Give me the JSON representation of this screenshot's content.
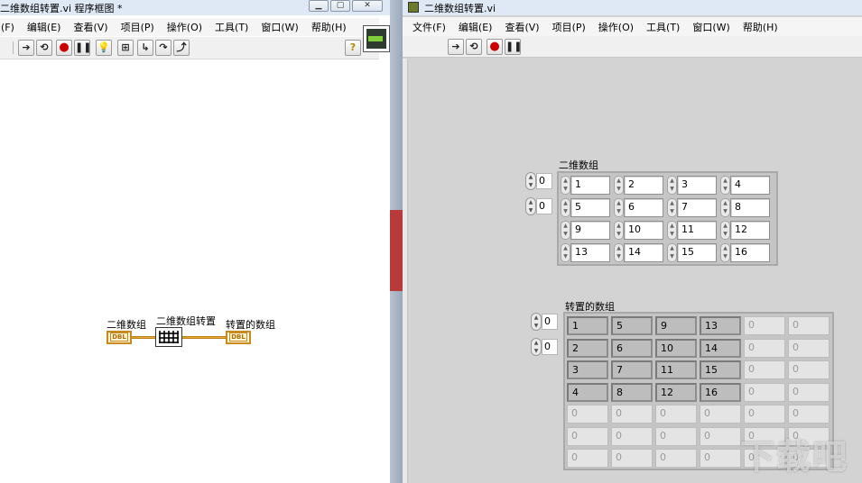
{
  "left_window": {
    "title": "二维数组转置.vi 程序框图 *",
    "menus": [
      "(F)",
      "编辑(E)",
      "查看(V)",
      "项目(P)",
      "操作(O)",
      "工具(T)",
      "窗口(W)",
      "帮助(H)"
    ],
    "diagram": {
      "input_label": "二维数组",
      "input_type": "DBL",
      "function_label": "二维数组转置",
      "output_label": "转置的数组",
      "output_type": "DBL"
    }
  },
  "right_window": {
    "title": "二维数组转置.vi",
    "menus": [
      "文件(F)",
      "编辑(E)",
      "查看(V)",
      "项目(P)",
      "操作(O)",
      "工具(T)",
      "窗口(W)",
      "帮助(H)"
    ]
  },
  "input_array": {
    "label": "二维数组",
    "row_index": "0",
    "col_index": "0",
    "rows": [
      [
        "1",
        "2",
        "3",
        "4"
      ],
      [
        "5",
        "6",
        "7",
        "8"
      ],
      [
        "9",
        "10",
        "11",
        "12"
      ],
      [
        "13",
        "14",
        "15",
        "16"
      ]
    ]
  },
  "output_array": {
    "label": "转置的数组",
    "row_index": "0",
    "col_index": "0",
    "rows": [
      [
        "1",
        "5",
        "9",
        "13",
        "0",
        "0"
      ],
      [
        "2",
        "6",
        "10",
        "14",
        "0",
        "0"
      ],
      [
        "3",
        "7",
        "11",
        "15",
        "0",
        "0"
      ],
      [
        "4",
        "8",
        "12",
        "16",
        "0",
        "0"
      ],
      [
        "0",
        "0",
        "0",
        "0",
        "0",
        "0"
      ],
      [
        "0",
        "0",
        "0",
        "0",
        "0",
        "0"
      ],
      [
        "0",
        "0",
        "0",
        "0",
        "0",
        "0"
      ]
    ],
    "active_rows": 4,
    "active_cols": 4
  }
}
